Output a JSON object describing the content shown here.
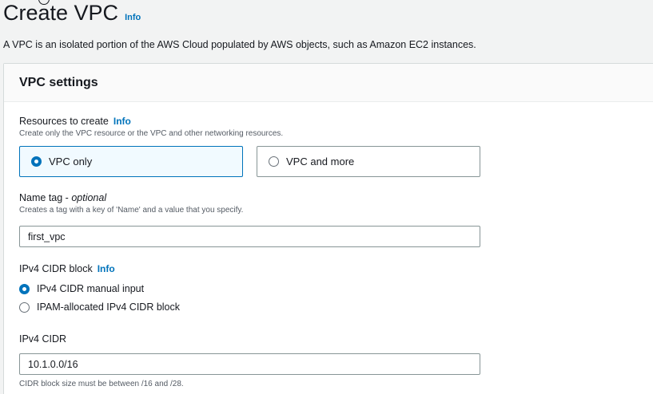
{
  "header": {
    "title": "Create VPC",
    "info_label": "Info",
    "description": "A VPC is an isolated portion of the AWS Cloud populated by AWS objects, such as Amazon EC2 instances."
  },
  "panel": {
    "title": "VPC settings"
  },
  "resources": {
    "label": "Resources to create",
    "info_label": "Info",
    "hint": "Create only the VPC resource or the VPC and other networking resources.",
    "options": [
      {
        "label": "VPC only",
        "selected": true
      },
      {
        "label": "VPC and more",
        "selected": false
      }
    ]
  },
  "name_tag": {
    "label": "Name tag - ",
    "optional": "optional",
    "hint": "Creates a tag with a key of 'Name' and a value that you specify.",
    "value": "first_vpc"
  },
  "ipv4_cidr_block": {
    "label": "IPv4 CIDR block",
    "info_label": "Info",
    "options": [
      {
        "label": "IPv4 CIDR manual input",
        "selected": true
      },
      {
        "label": "IPAM-allocated IPv4 CIDR block",
        "selected": false
      }
    ]
  },
  "ipv4_cidr": {
    "label": "IPv4 CIDR",
    "value": "10.1.0.0/16",
    "constraint": "CIDR block size must be between /16 and /28."
  },
  "colors": {
    "accent": "#0073bb",
    "background": "#f2f3f3",
    "panel_header": "#fafafa",
    "text": "#16191f",
    "hint_text": "#545b64"
  }
}
